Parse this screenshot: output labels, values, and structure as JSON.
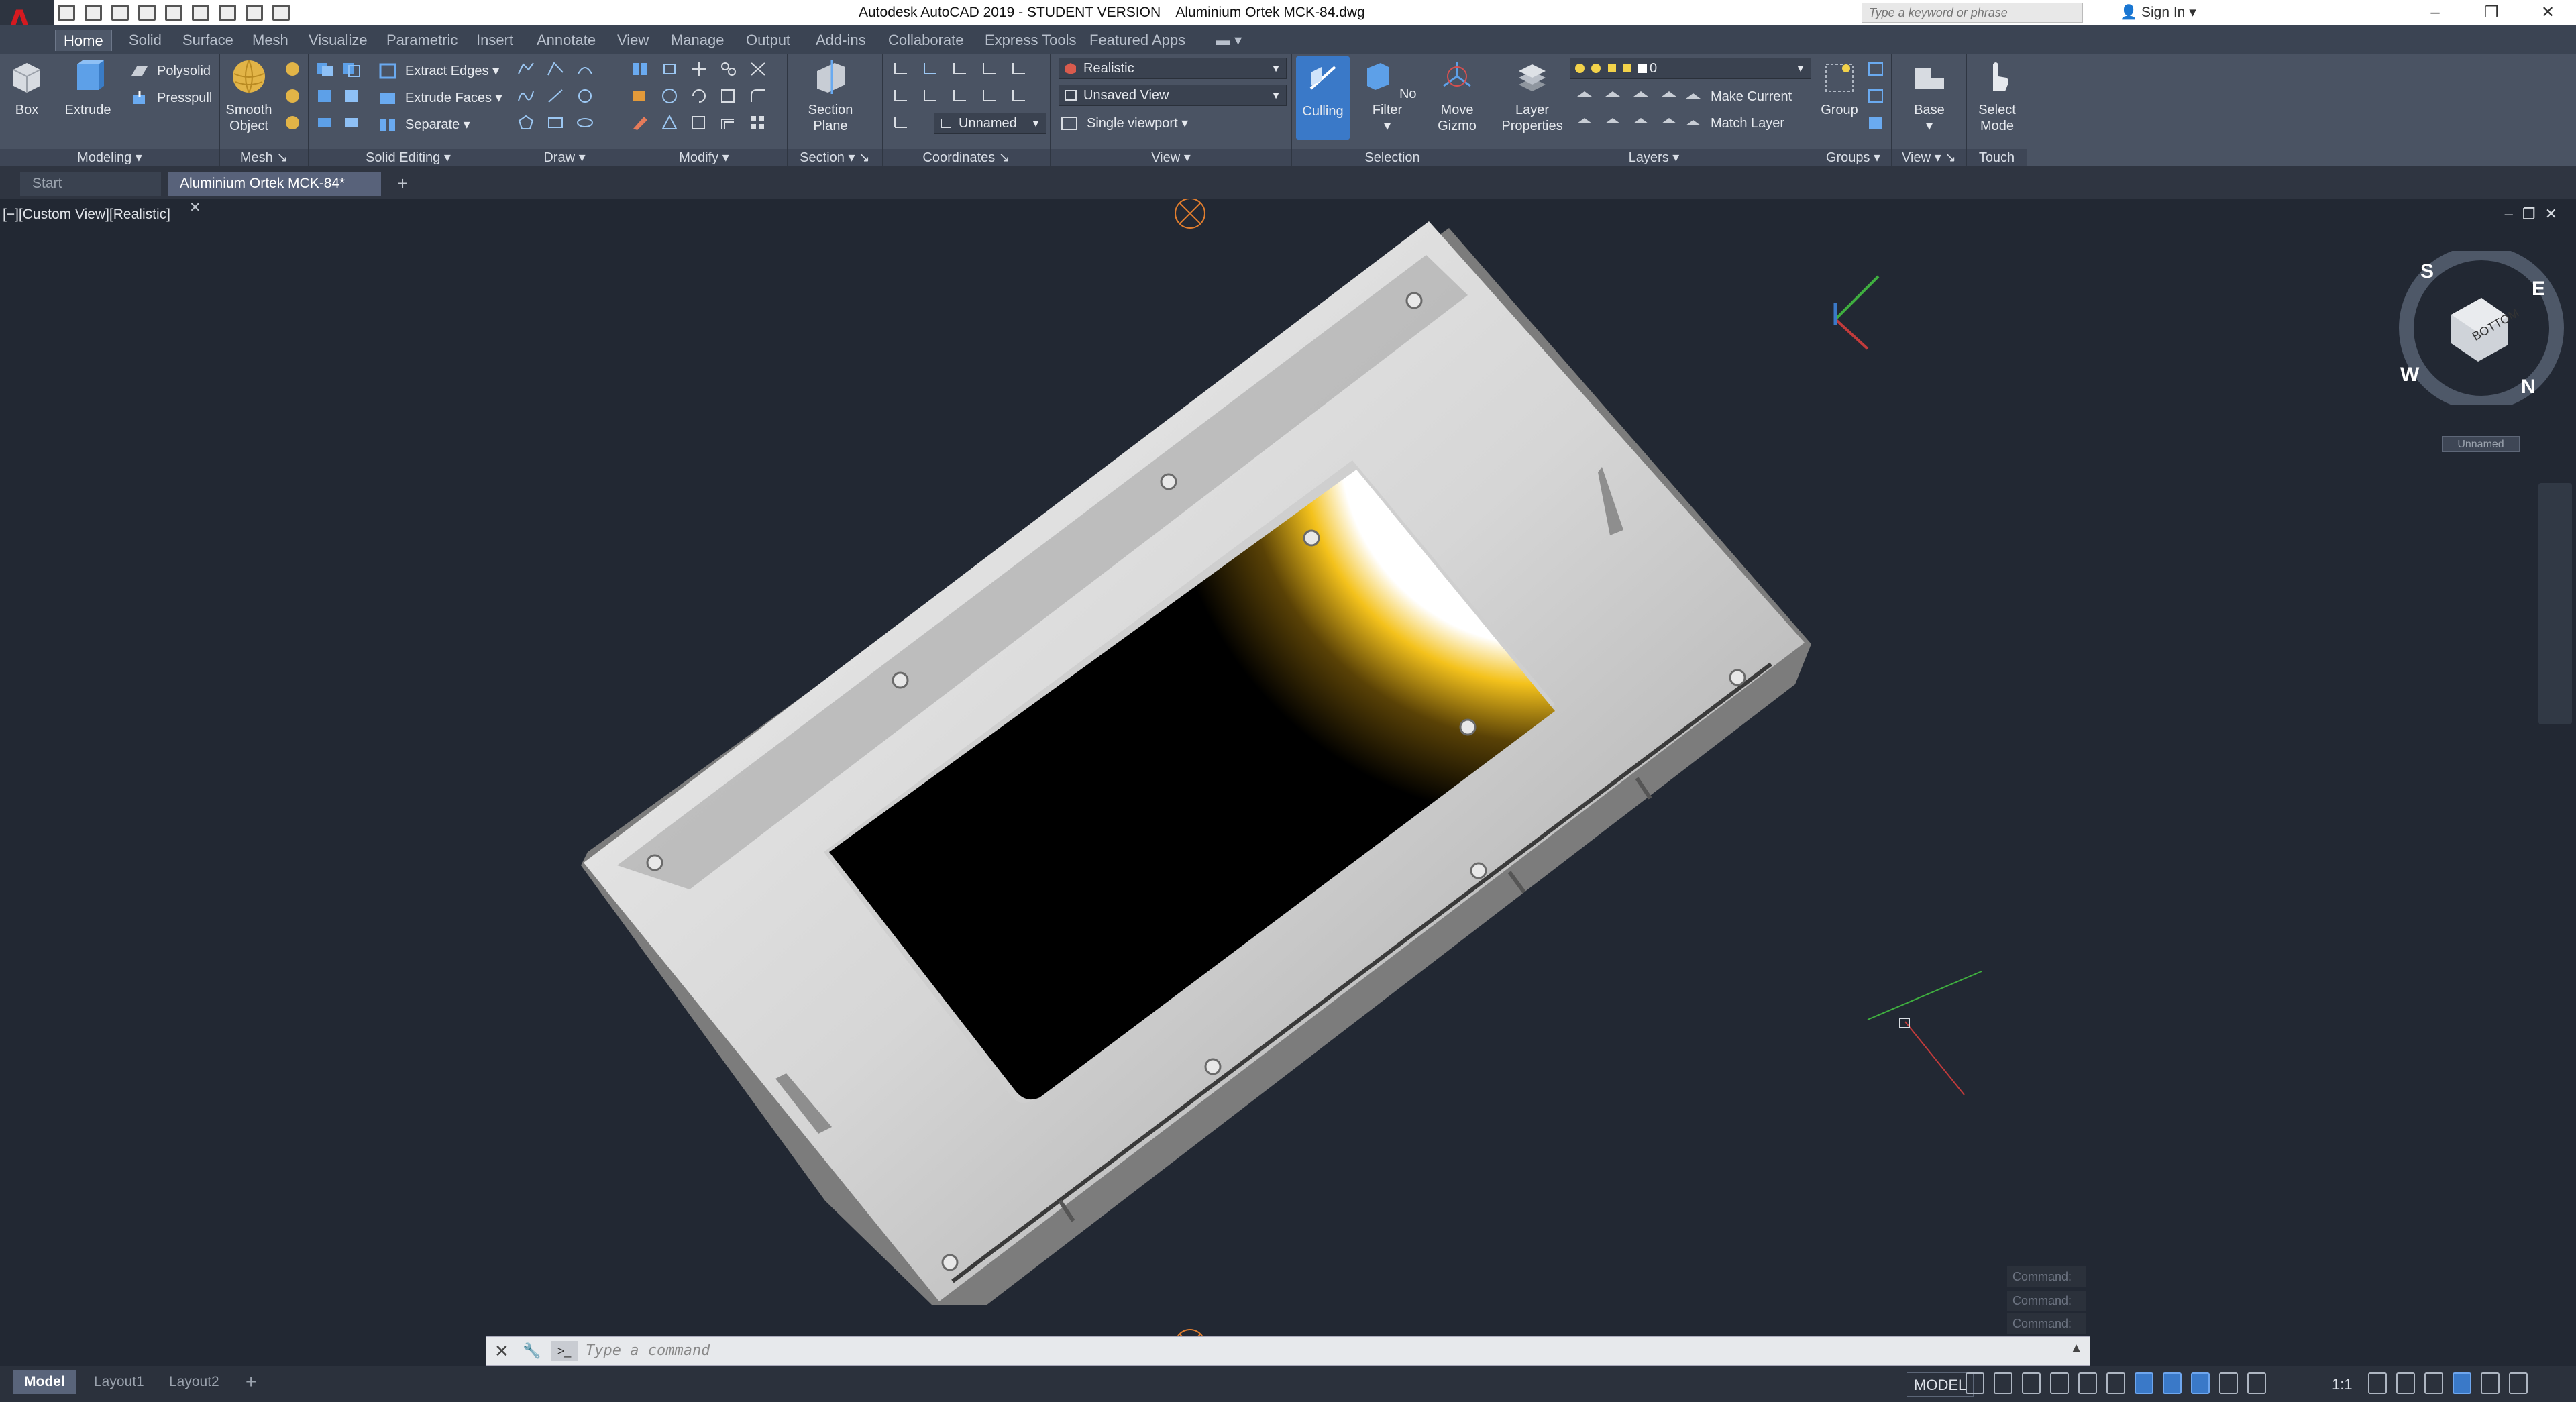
{
  "titlebar": {
    "app_title": "Autodesk AutoCAD 2019 - STUDENT VERSION",
    "file_name": "Aluminium Ortek MCK-84.dwg",
    "search_placeholder": "Type a keyword or phrase",
    "sign_in": "Sign In"
  },
  "ribbon_tabs": [
    "Home",
    "Solid",
    "Surface",
    "Mesh",
    "Visualize",
    "Parametric",
    "Insert",
    "Annotate",
    "View",
    "Manage",
    "Output",
    "Add-ins",
    "Collaborate",
    "Express Tools",
    "Featured Apps"
  ],
  "ribbon": {
    "modeling": {
      "title": "Modeling",
      "box": "Box",
      "extrude": "Extrude",
      "polysolid": "Polysolid",
      "presspull": "Presspull"
    },
    "mesh": {
      "title": "Mesh",
      "smooth_object": "Smooth Object"
    },
    "solid_editing": {
      "title": "Solid Editing",
      "extract_edges": "Extract Edges",
      "extrude_faces": "Extrude Faces",
      "separate": "Separate"
    },
    "draw": {
      "title": "Draw"
    },
    "modify": {
      "title": "Modify"
    },
    "section": {
      "title": "Section",
      "section_plane": "Section Plane"
    },
    "coordinates": {
      "title": "Coordinates",
      "ucs_value": "Unnamed"
    },
    "view": {
      "title": "View",
      "visual_style": "Realistic",
      "saved_view": "Unsaved View",
      "viewport": "Single viewport"
    },
    "selection": {
      "title": "Selection",
      "culling": "Culling",
      "no_filter": "No Filter",
      "move_gizmo": "Move Gizmo"
    },
    "layers": {
      "title": "Layers",
      "layer_properties": "Layer Properties",
      "current_layer": "0",
      "make_current": "Make Current",
      "match_layer": "Match Layer"
    },
    "groups": {
      "title": "Groups",
      "group": "Group"
    },
    "view2": {
      "title": "View",
      "base": "Base"
    },
    "touch": {
      "title": "Touch",
      "select_mode": "Select Mode"
    }
  },
  "doc_tabs": {
    "start": "Start",
    "active": "Aluminium Ortek MCK-84*"
  },
  "viewport": {
    "label": "[−][Custom View][Realistic]",
    "viewcube": {
      "face": "BOTTOM",
      "n": "N",
      "s": "S",
      "e": "E",
      "w": "W",
      "ucs_name": "Unnamed"
    }
  },
  "command": {
    "history": [
      "Command:",
      "Command:",
      "Command:"
    ],
    "placeholder": "Type a command"
  },
  "layout_tabs": [
    "Model",
    "Layout1",
    "Layout2"
  ],
  "status": {
    "model": "MODEL",
    "scale": "1:1"
  },
  "colors": {
    "canvas": "#222833",
    "ribbon": "#4a5363",
    "accent": "#3a79c8"
  }
}
